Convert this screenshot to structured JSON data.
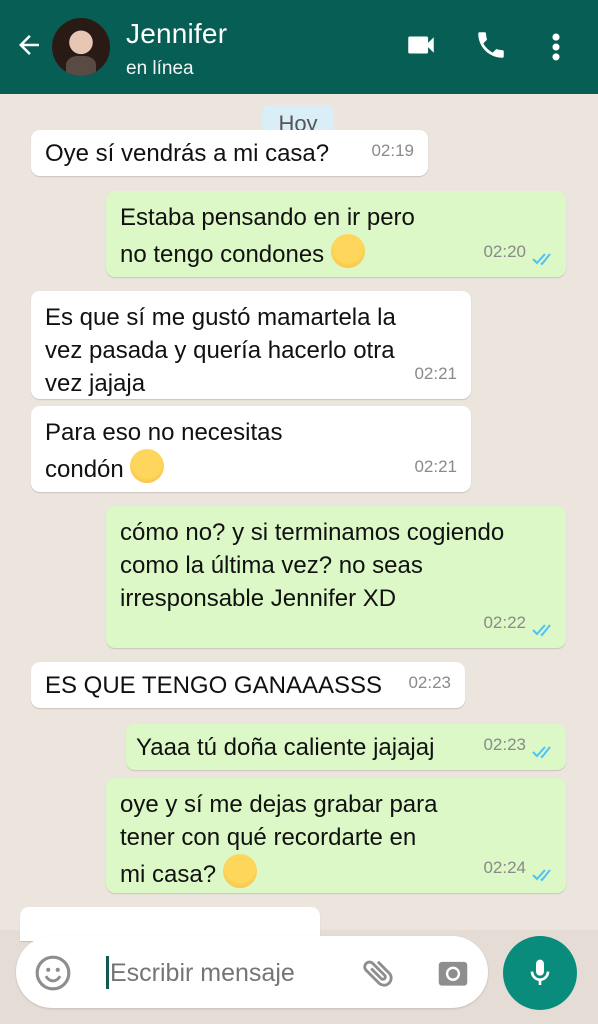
{
  "header": {
    "contact_name": "Jennifer",
    "status": "en línea",
    "icons": [
      "back-arrow-icon",
      "avatar",
      "video-call-icon",
      "phone-icon",
      "more-vert-icon"
    ],
    "colors": {
      "bar": "#075e54",
      "wallpaper": "#ece5dd",
      "incoming": "#ffffff",
      "outgoing": "#dcf8c6"
    }
  },
  "date_chip": "Hoy",
  "messages": [
    {
      "dir": "in",
      "text": "Oye sí vendrás a mi casa?",
      "time": "02:19"
    },
    {
      "dir": "out",
      "text": "Estaba pensando en ir pero no tengo condones",
      "emoji": "sweat-smile",
      "time": "02:20",
      "ticks": "read"
    },
    {
      "dir": "in",
      "text": "Es que sí me gustó mamartela la vez pasada y quería hacerlo otra vez jajaja",
      "time": "02:21"
    },
    {
      "dir": "in",
      "text": "Para eso no necesitas condón",
      "emoji": "tears-of-joy",
      "time": "02:21"
    },
    {
      "dir": "out",
      "text": "cómo no? y si terminamos cogiendo como la última vez? no seas irresponsable Jennifer XD",
      "time": "02:22",
      "ticks": "read"
    },
    {
      "dir": "in",
      "text": "ES QUE TENGO GANAAASSS",
      "time": "02:23"
    },
    {
      "dir": "out",
      "text": "Yaaa tú doña caliente jajajaj",
      "time": "02:23",
      "ticks": "read"
    },
    {
      "dir": "out",
      "text": "oye y sí me dejas grabar para tener con qué recordarte en mi casa?",
      "emoji": "pleading-face",
      "time": "02:24",
      "ticks": "read"
    }
  ],
  "composer": {
    "placeholder": "Escribir mensaje",
    "icons": [
      "emoji-icon",
      "attach-icon",
      "camera-icon",
      "mic-icon"
    ]
  }
}
